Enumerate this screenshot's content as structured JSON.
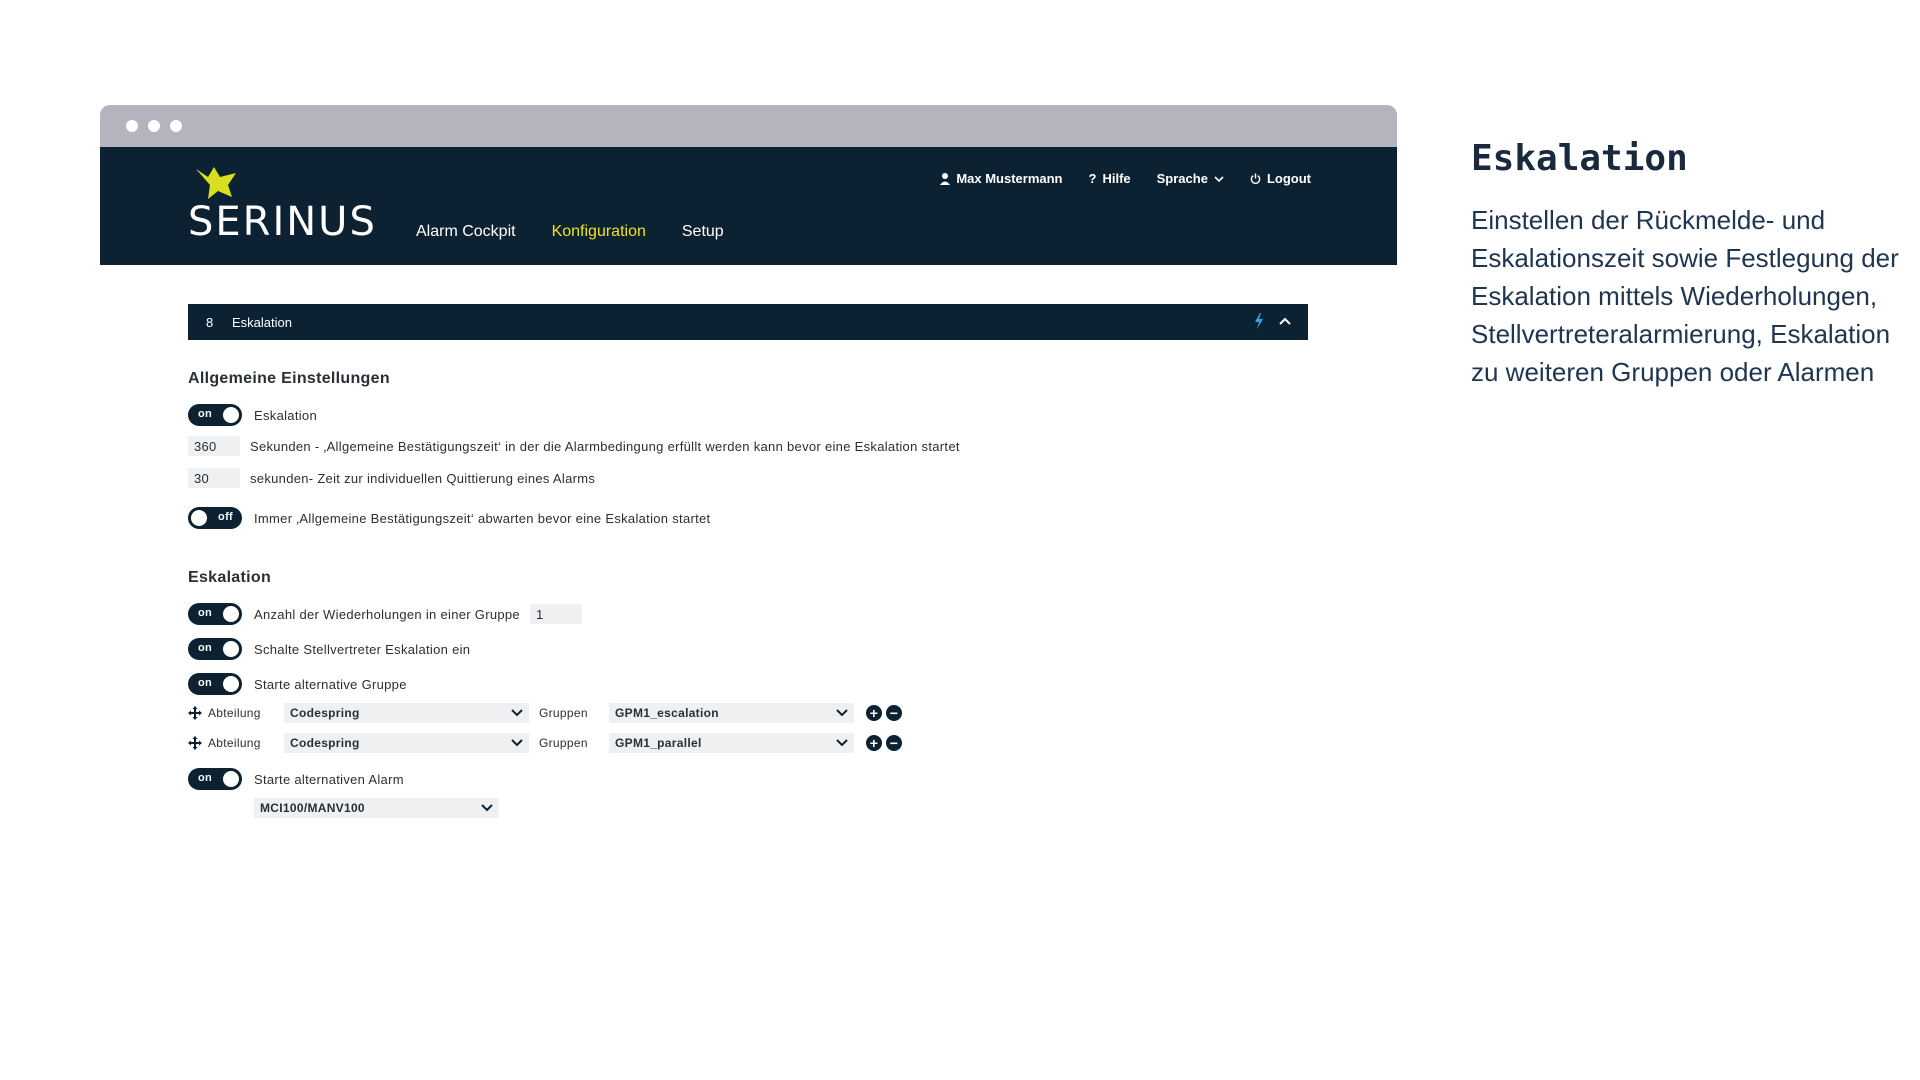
{
  "app": {
    "logo_text": "SERINUS",
    "user_name": "Max Mustermann",
    "help_label": "Hilfe",
    "language_label": "Sprache",
    "logout_label": "Logout",
    "nav": [
      "Alarm Cockpit",
      "Konfiguration",
      "Setup"
    ],
    "active_nav": "Konfiguration"
  },
  "panel": {
    "number": "8",
    "title": "Eskalation",
    "general": {
      "heading": "Allgemeine Einstellungen",
      "escalation_toggle": {
        "state": "on",
        "label": "Eskalation"
      },
      "confirm_time": {
        "value": "360",
        "text": "Sekunden - ‚Allgemeine Bestätigungszeit‘ in der die Alarmbedingung erfüllt werden kann bevor eine Eskalation startet"
      },
      "ack_time": {
        "value": "30",
        "text": "sekunden- Zeit zur individuellen Quittierung eines Alarms"
      },
      "wait_toggle": {
        "state": "off",
        "label": "Immer ‚Allgemeine Bestätigungszeit‘ abwarten bevor eine Eskalation startet"
      }
    },
    "escalation": {
      "heading": "Eskalation",
      "repeat_toggle": {
        "state": "on",
        "label": "Anzahl der Wiederholungen in einer Gruppe",
        "value": "1"
      },
      "deputy_toggle": {
        "state": "on",
        "label": "Schalte Stellvertreter Eskalation ein"
      },
      "alt_group_toggle": {
        "state": "on",
        "label": "Starte alternative Gruppe"
      },
      "group_rows": [
        {
          "dept_label": "Abteilung",
          "dept": "Codespring",
          "groups_label": "Gruppen",
          "group": "GPM1_escalation"
        },
        {
          "dept_label": "Abteilung",
          "dept": "Codespring",
          "groups_label": "Gruppen",
          "group": "GPM1_parallel"
        }
      ],
      "alt_alarm_toggle": {
        "state": "on",
        "label": "Starte alternativen Alarm"
      },
      "alarm_select": "MCI100/MANV100"
    }
  },
  "description": {
    "title": "Eskalation",
    "text": "Einstellen der Rückmelde- und Eskalationszeit sowie Festlegung der Eskalation mittels Wiederholungen, Stellvertreteralarmierung, Eskalation zu weiteren Gruppen oder Alarmen"
  },
  "colors": {
    "navy": "#0c2233",
    "accent_yellow": "#f0e01e",
    "chrome_grey": "#b4b4be",
    "field_bg": "#eef0f2"
  }
}
